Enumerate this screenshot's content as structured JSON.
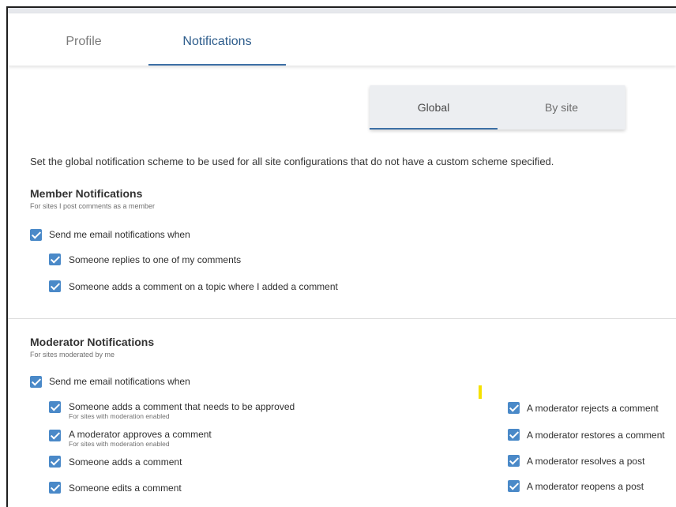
{
  "tabs": {
    "profile": "Profile",
    "notifications": "Notifications"
  },
  "scope": {
    "global": "Global",
    "by_site": "By site"
  },
  "intro": "Set the global notification scheme to be used for all site configurations that do not have a custom scheme specified.",
  "member": {
    "title": "Member Notifications",
    "subtitle": "For sites I post comments as a member",
    "master": "Send me email notifications when",
    "options": [
      {
        "label": "Someone replies to one of my comments",
        "checked": true
      },
      {
        "label": "Someone adds a comment on a topic where I added a comment",
        "checked": true
      }
    ],
    "master_checked": true
  },
  "moderator": {
    "title": "Moderator Notifications",
    "subtitle": "For sites moderated by me",
    "master": "Send me email notifications when",
    "master_checked": true,
    "left_options": [
      {
        "label": "Someone adds a comment that needs to be approved",
        "note": "For sites with moderation enabled",
        "checked": true
      },
      {
        "label": "A moderator approves a comment",
        "note": "For sites with moderation enabled",
        "checked": true
      },
      {
        "label": "Someone adds a comment",
        "checked": true
      },
      {
        "label": "Someone edits a comment",
        "checked": true
      }
    ],
    "right_options": [
      {
        "label": "A moderator rejects a comment",
        "checked": true
      },
      {
        "label": "A moderator restores a comment",
        "checked": true
      },
      {
        "label": "A moderator resolves a post",
        "checked": true
      },
      {
        "label": "A moderator reopens a post",
        "checked": true
      }
    ]
  },
  "colors": {
    "accent": "#3d6fa5",
    "checkbox": "#4a89c8"
  }
}
